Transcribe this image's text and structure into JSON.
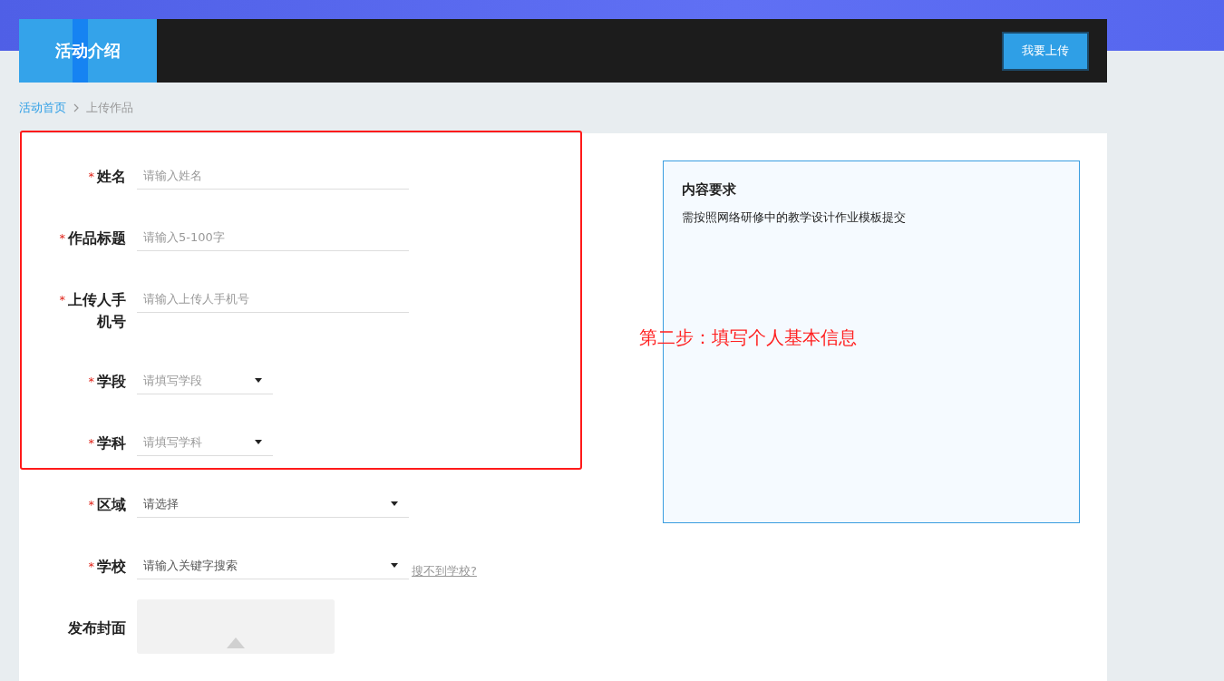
{
  "nav": {
    "tab": "活动介绍",
    "upload_button": "我要上传"
  },
  "breadcrumb": [
    {
      "label": "活动首页",
      "kind": "link"
    },
    {
      "label": "上传作品",
      "kind": "current"
    }
  ],
  "form": {
    "fields": [
      {
        "kind": "text",
        "required_mark": "*",
        "label": "姓名",
        "placeholder": "请输入姓名"
      },
      {
        "kind": "text",
        "required_mark": "*",
        "label": "作品标题",
        "placeholder": "请输入5-100字"
      },
      {
        "kind": "text",
        "required_mark": "*",
        "label": "上传人手机号",
        "placeholder": "请输入上传人手机号"
      },
      {
        "kind": "select-short",
        "required_mark": "*",
        "label": "学段",
        "placeholder": "请填写学段"
      },
      {
        "kind": "select-short",
        "required_mark": "*",
        "label": "学科",
        "placeholder": "请填写学科"
      },
      {
        "kind": "select",
        "required_mark": "*",
        "label": "区域",
        "value": "请选择"
      },
      {
        "kind": "select",
        "required_mark": "*",
        "label": "学校",
        "value": "请输入关键字搜索",
        "link": "搜不到学校?"
      },
      {
        "kind": "upload",
        "label": "发布封面"
      }
    ]
  },
  "annotation": "第二步：填写个人基本信息",
  "requirements": {
    "title": "内容要求",
    "text": "需按照网络研修中的教学设计作业模板提交"
  }
}
